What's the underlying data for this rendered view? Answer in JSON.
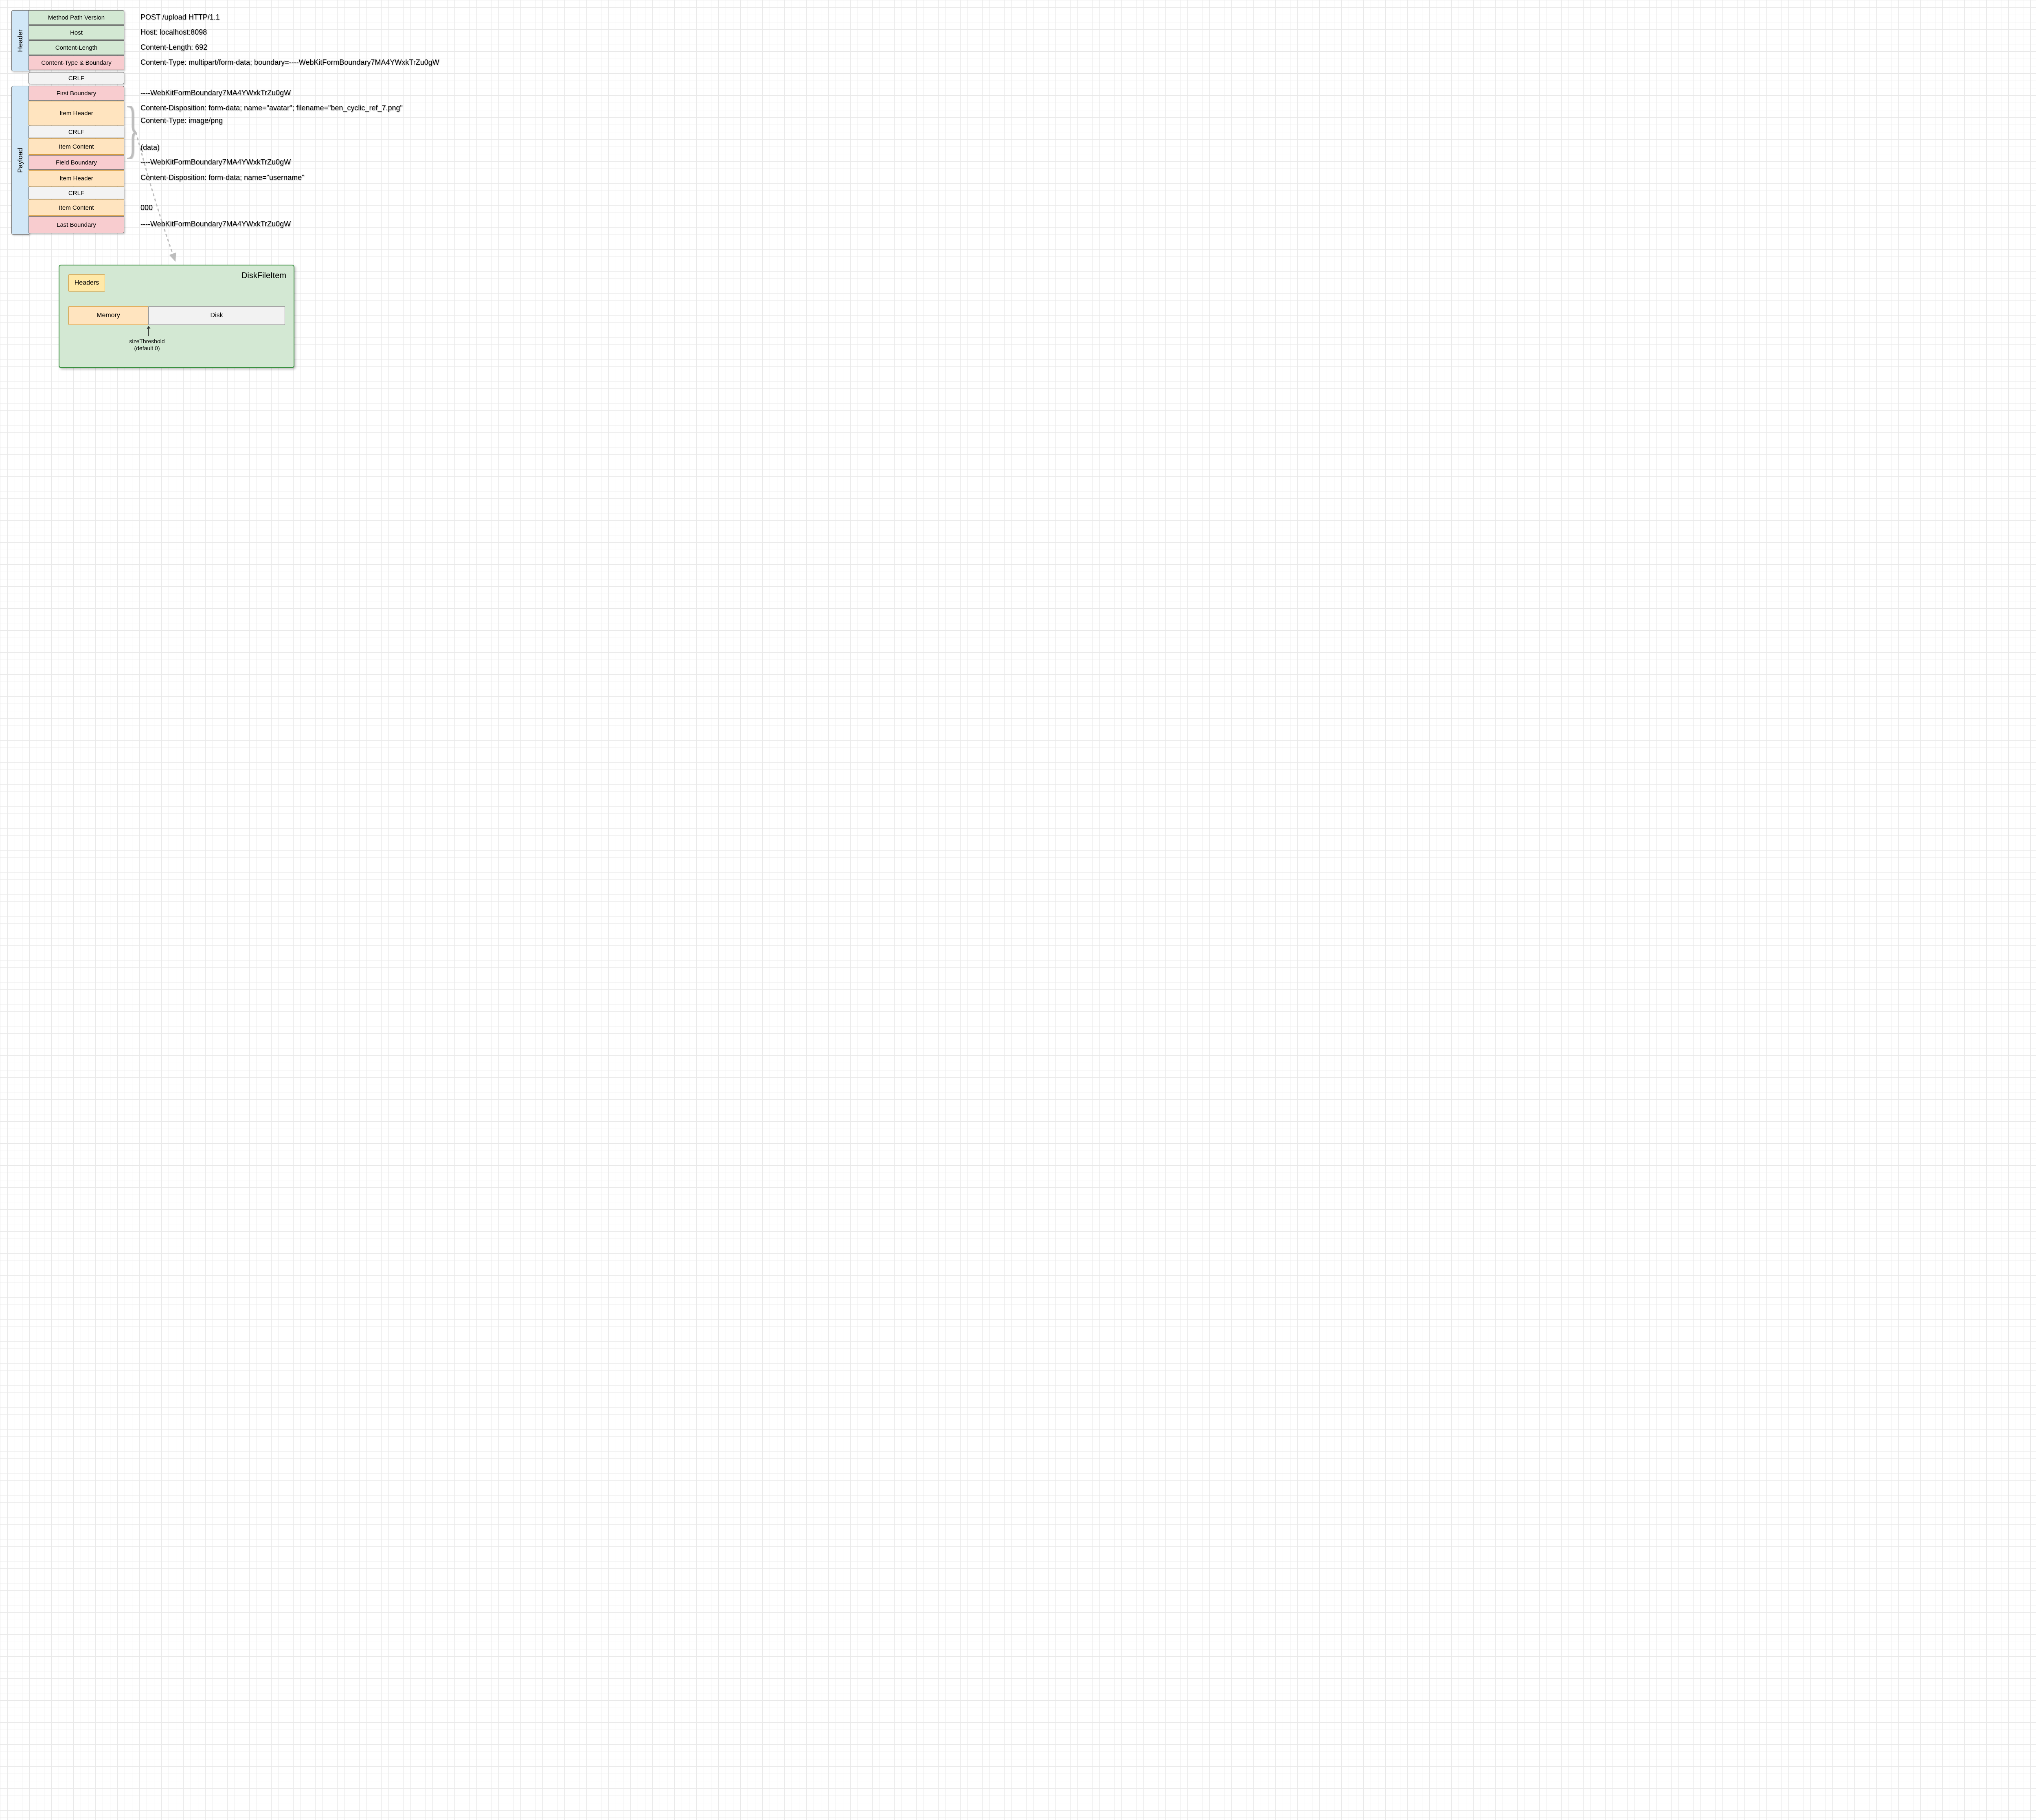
{
  "sections": {
    "header": {
      "label": "Header",
      "rows": [
        "Method Path Version",
        "Host",
        "Content-Length",
        "Content-Type & Boundary"
      ]
    },
    "crlf1": "CRLF",
    "payload": {
      "label": "Payload",
      "rows": [
        "First Boundary",
        "Item Header",
        "CRLF",
        "Item Content",
        "Field Boundary",
        "Item Header",
        "CRLF",
        "Item Content",
        "Last Boundary"
      ]
    }
  },
  "raw": {
    "l0": "POST /upload HTTP/1.1",
    "l1": "Host: localhost:8098",
    "l2": "Content-Length: 692",
    "l3": "Content-Type: multipart/form-data; boundary=----WebKitFormBoundary7MA4YWxkTrZu0gW",
    "l5": "----WebKitFormBoundary7MA4YWxkTrZu0gW",
    "l6": "Content-Disposition: form-data; name=\"avatar\"; filename=\"ben_cyclic_ref_7.png\"",
    "l7": "Content-Type: image/png",
    "l9": "(data)",
    "l10": "----WebKitFormBoundary7MA4YWxkTrZu0gW",
    "l11": "Content-Disposition: form-data; name=\"username\"",
    "l13": "000",
    "l14": "----WebKitFormBoundary7MA4YWxkTrZu0gW"
  },
  "panel": {
    "title": "DiskFileItem",
    "headers": "Headers",
    "memory": "Memory",
    "disk": "Disk",
    "note1": "sizeThreshold",
    "note2": "(default 0)"
  }
}
